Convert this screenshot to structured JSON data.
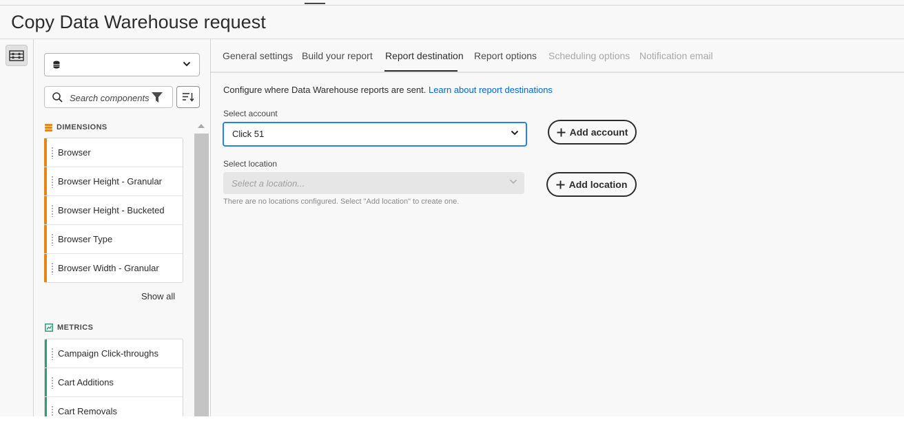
{
  "page": {
    "title": "Copy Data Warehouse request"
  },
  "panel": {
    "data_source_value": "",
    "search_placeholder": "Search components",
    "dimensions": {
      "heading": "DIMENSIONS",
      "items": [
        "Browser",
        "Browser Height - Granular",
        "Browser Height - Bucketed",
        "Browser Type",
        "Browser Width - Granular"
      ],
      "show_all": "Show all",
      "color": "#e68619"
    },
    "metrics": {
      "heading": "METRICS",
      "items": [
        "Campaign Click-throughs",
        "Cart Additions",
        "Cart Removals"
      ],
      "color": "#2d9d78"
    }
  },
  "tabs": [
    {
      "label": "General settings",
      "state": "normal"
    },
    {
      "label": "Build your report",
      "state": "normal"
    },
    {
      "label": "Report destination",
      "state": "active"
    },
    {
      "label": "Report options",
      "state": "normal"
    },
    {
      "label": "Scheduling options",
      "state": "disabled"
    },
    {
      "label": "Notification email",
      "state": "disabled"
    }
  ],
  "main": {
    "intro_text": "Configure where Data Warehouse reports are sent.",
    "intro_link": "Learn about report destinations",
    "account": {
      "label": "Select account",
      "value": "Click 51",
      "add_button": "Add account"
    },
    "location": {
      "label": "Select location",
      "placeholder": "Select a location...",
      "help": "There are no locations configured. Select \"Add location\" to create one.",
      "add_button": "Add location"
    }
  },
  "icons": {
    "rail": "panel-toggle-icon",
    "data_source": "database-icon",
    "search": "search-icon",
    "filter": "filter-icon",
    "sort": "sort-icon",
    "dimensions": "dimensions-icon",
    "metrics": "metrics-icon",
    "add": "plus-icon"
  },
  "colors": {
    "accent": "#2680eb",
    "link": "#0265dc"
  }
}
